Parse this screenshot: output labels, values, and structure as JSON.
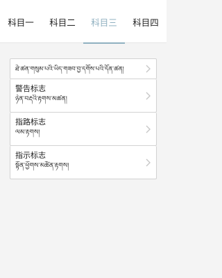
{
  "tabs": [
    {
      "label": "科目一",
      "active": false
    },
    {
      "label": "科目二",
      "active": false
    },
    {
      "label": "科目三",
      "active": true
    },
    {
      "label": "科目四",
      "active": false
    }
  ],
  "colors": {
    "accent": "#8fb0c0",
    "card_border": "#d2d2d2",
    "background": "#f4f4f4"
  },
  "items": [
    {
      "title": "",
      "subtitle": "ཐེ་ཚན་གསུམ་པའི་ཡིད་གཟབ་བྱ་དགོས་པའི་དོན་ཚན།",
      "icon": "chevron-right-icon"
    },
    {
      "title": "警告标志",
      "subtitle": "ཉེན་བརྡའི་རྟགས་མཚན།",
      "icon": "chevron-right-icon"
    },
    {
      "title": "指路标志",
      "subtitle": "ལམ་རྟགས།",
      "icon": "chevron-right-icon"
    },
    {
      "title": "指示标志",
      "subtitle": "སྟོན་ཕྱོགས་མཚོན་རྟགས།",
      "icon": "chevron-right-icon"
    }
  ]
}
